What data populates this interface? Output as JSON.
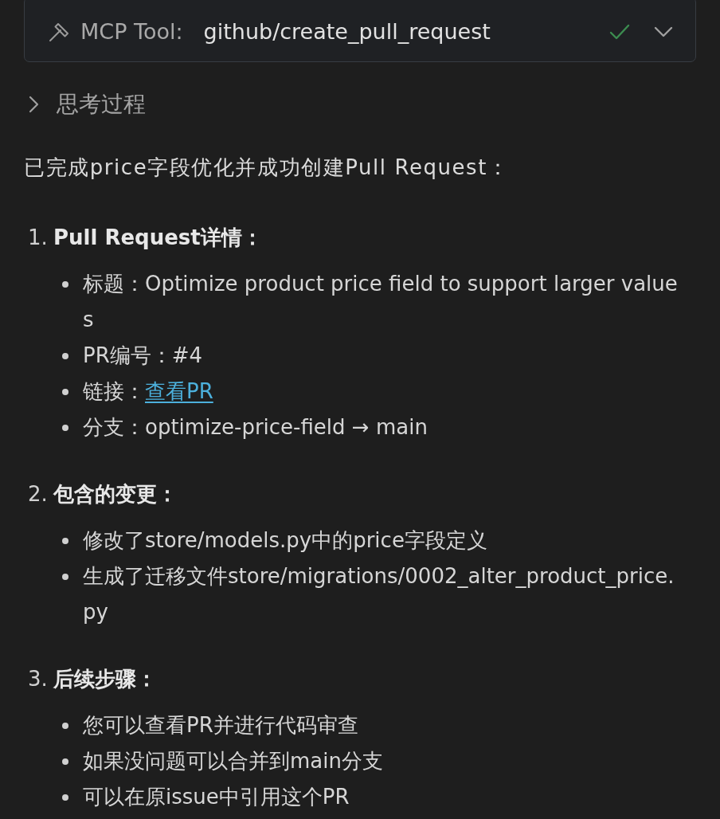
{
  "tool_call": {
    "label": "MCP Tool:",
    "name": "github/create_pull_request",
    "succeeded": true
  },
  "thinking": {
    "label": "思考过程",
    "expanded": false
  },
  "message": {
    "intro": "已完成price字段优化并成功创建Pull Request：",
    "sections": [
      {
        "number": "1.",
        "heading": "Pull Request详情：",
        "items": [
          {
            "kind": "text",
            "text": "标题：Optimize product price field to support larger values"
          },
          {
            "kind": "text",
            "text": "PR编号：#4"
          },
          {
            "kind": "link",
            "text": "链接：",
            "link": "查看PR"
          },
          {
            "kind": "text",
            "text": "分支：optimize-price-field → main"
          }
        ]
      },
      {
        "number": "2.",
        "heading": "包含的变更：",
        "items": [
          {
            "kind": "text",
            "text": "修改了store/models.py中的price字段定义"
          },
          {
            "kind": "text",
            "text": "生成了迁移文件store/migrations/0002_alter_product_price.py"
          }
        ]
      },
      {
        "number": "3.",
        "heading": "后续步骤：",
        "items": [
          {
            "kind": "text",
            "text": "您可以查看PR并进行代码审查"
          },
          {
            "kind": "text",
            "text": "如果没问题可以合并到main分支"
          },
          {
            "kind": "text",
            "text": "可以在原issue中引用这个PR"
          }
        ]
      }
    ]
  }
}
